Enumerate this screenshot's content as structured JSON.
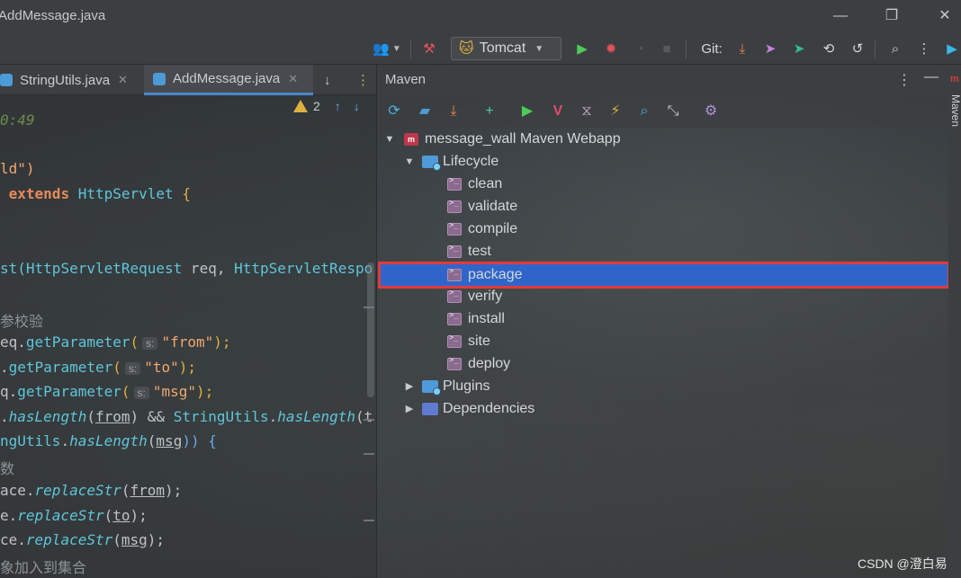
{
  "window": {
    "title": "AddMessage.java"
  },
  "toolbar": {
    "run_config": "Tomcat",
    "git_label": "Git:"
  },
  "editor": {
    "tabs": [
      {
        "label": "StringUtils.java"
      },
      {
        "label": "AddMessage.java",
        "active": true
      }
    ],
    "warning_count": "2",
    "lines": {
      "l1": "0:49",
      "l2a": "ld\")",
      "l3a": "extends",
      "l3b": "HttpServlet",
      "l3c": " {",
      "l4a": "st(",
      "l4b": "HttpServletRequest",
      "l4c": " req, ",
      "l4d": "HttpServletRespo",
      "l5": "参校验",
      "l6a": "eq.",
      "l6b": "getParameter",
      "l6c": "(",
      "l6h": "s:",
      "l6d": "\"from\"",
      "l6e": ");",
      "l7a": ".",
      "l7b": "getParameter",
      "l7c": "(",
      "l7h": "s:",
      "l7d": "\"to\"",
      "l7e": ");",
      "l8a": "q.",
      "l8b": "getParameter",
      "l8c": "(",
      "l8h": "s:",
      "l8d": "\"msg\"",
      "l8e": ");",
      "l9a": ".",
      "l9b": "hasLength",
      "l9c": "(",
      "l9d": "from",
      "l9e": ") && ",
      "l9f": "StringUtils",
      "l9g": ".",
      "l9h": "hasLength",
      "l9i": "(t",
      "l10a": "ngUtils",
      "l10b": ".",
      "l10c": "hasLength",
      "l10d": "(",
      "l10e": "msg",
      "l10f": ")) {",
      "l11": "数",
      "l12a": "ace.",
      "l12b": "replaceStr",
      "l12c": "(",
      "l12d": "from",
      "l12e": ");",
      "l13a": "e.",
      "l13b": "replaceStr",
      "l13c": "(",
      "l13d": "to",
      "l13e": ");",
      "l14a": "ce.",
      "l14b": "replaceStr",
      "l14c": "(",
      "l14d": "msg",
      "l14e": ");",
      "l15": "象加入到集合"
    }
  },
  "maven": {
    "title": "Maven",
    "project": "message_wall Maven Webapp",
    "lifecycle_label": "Lifecycle",
    "goals": [
      "clean",
      "validate",
      "compile",
      "test",
      "package",
      "verify",
      "install",
      "site",
      "deploy"
    ],
    "selected_goal": "package",
    "plugins_label": "Plugins",
    "dependencies_label": "Dependencies",
    "strip_label": "Maven"
  },
  "watermark": "CSDN @澄白易",
  "colors": {
    "selection": "#2f65ca",
    "highlight_box": "#e03b3b",
    "run_green": "#4ccb5a",
    "debug_red": "#e8505b"
  }
}
